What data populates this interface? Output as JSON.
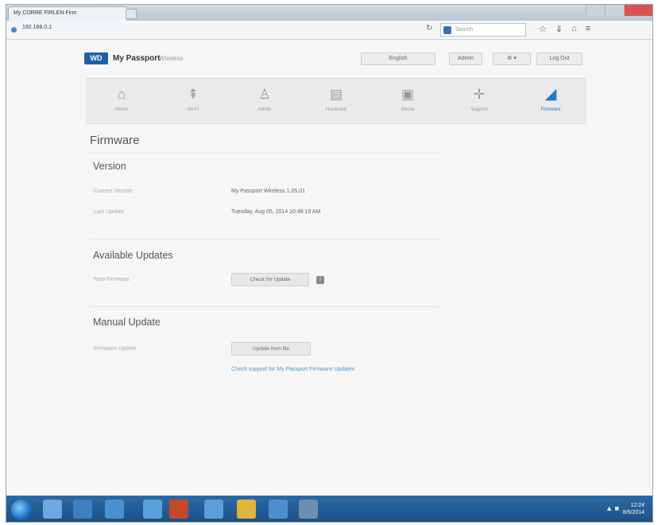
{
  "browser": {
    "tab_title": "My CORRE FIRLEN Firm",
    "url": "192.168.0.1",
    "search_placeholder": "Search",
    "reload_glyph": "↻",
    "nav_icons": [
      "star-icon",
      "download-icon",
      "home-icon",
      "menu-icon"
    ]
  },
  "header": {
    "logo": "WD",
    "brand": "My Passport",
    "brand_sub": "Wireless",
    "language": "English",
    "user": "Admin",
    "logout": "Log Out"
  },
  "nav": {
    "items": [
      {
        "label": "Home",
        "icon": "home-icon",
        "glyph": "⌂",
        "active": false
      },
      {
        "label": "Wi-Fi",
        "icon": "wifi-icon",
        "glyph": "⇞",
        "active": false
      },
      {
        "label": "Admin",
        "icon": "admin-icon",
        "glyph": "♙",
        "active": false
      },
      {
        "label": "Hardware",
        "icon": "hardware-icon",
        "glyph": "▤",
        "active": false
      },
      {
        "label": "Media",
        "icon": "media-icon",
        "glyph": "▣",
        "active": false
      },
      {
        "label": "Support",
        "icon": "support-icon",
        "glyph": "✛",
        "active": false
      },
      {
        "label": "Firmware",
        "icon": "firmware-icon",
        "glyph": "◢",
        "active": true
      }
    ]
  },
  "main": {
    "title": "Firmware",
    "version": {
      "heading": "Version",
      "current_label": "Current Version",
      "current_value": "My Passport Wireless 1.05.01",
      "last_update_label": "Last Update",
      "last_update_value": "Tuesday, Aug 05, 2014 10:48:15 AM"
    },
    "available": {
      "heading": "Available Updates",
      "new_label": "New Firmware",
      "check_button": "Check for Update",
      "info_glyph": "i"
    },
    "manual": {
      "heading": "Manual Update",
      "file_label": "Firmware Update",
      "update_button": "Update from file",
      "link": "Check support for My Passport Firmware Updates"
    }
  },
  "taskbar": {
    "time": "12:24",
    "date": "8/5/2014"
  }
}
